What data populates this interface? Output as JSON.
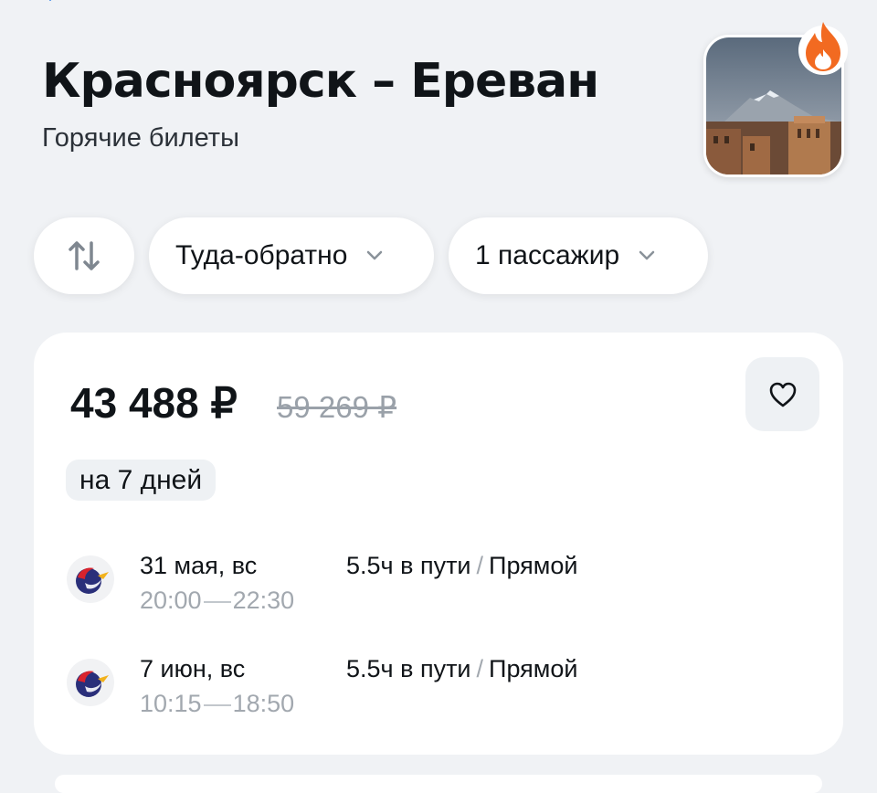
{
  "header": {
    "title": "Красноярск – Ереван",
    "subtitle": "Горячие билеты"
  },
  "filters": {
    "swap_icon": "swap-vertical-icon",
    "trip_type": "Туда-обратно",
    "passengers": "1 пассажир"
  },
  "offer": {
    "price": "43 488 ₽",
    "old_price": "59 269 ₽",
    "duration_badge": "на 7 дней",
    "segments": [
      {
        "date": "31 мая, вс",
        "departure": "20:00",
        "arrival": "22:30",
        "travel_time": "5.5ч в пути",
        "separator": "/",
        "stops": "Прямой"
      },
      {
        "date": "7 июн, вс",
        "departure": "10:15",
        "arrival": "18:50",
        "travel_time": "5.5ч в пути",
        "separator": "/",
        "stops": "Прямой"
      }
    ]
  },
  "colors": {
    "background": "#f0f2f5",
    "hot_badge": "#f26a21",
    "old_price": "#9aa1a9"
  }
}
